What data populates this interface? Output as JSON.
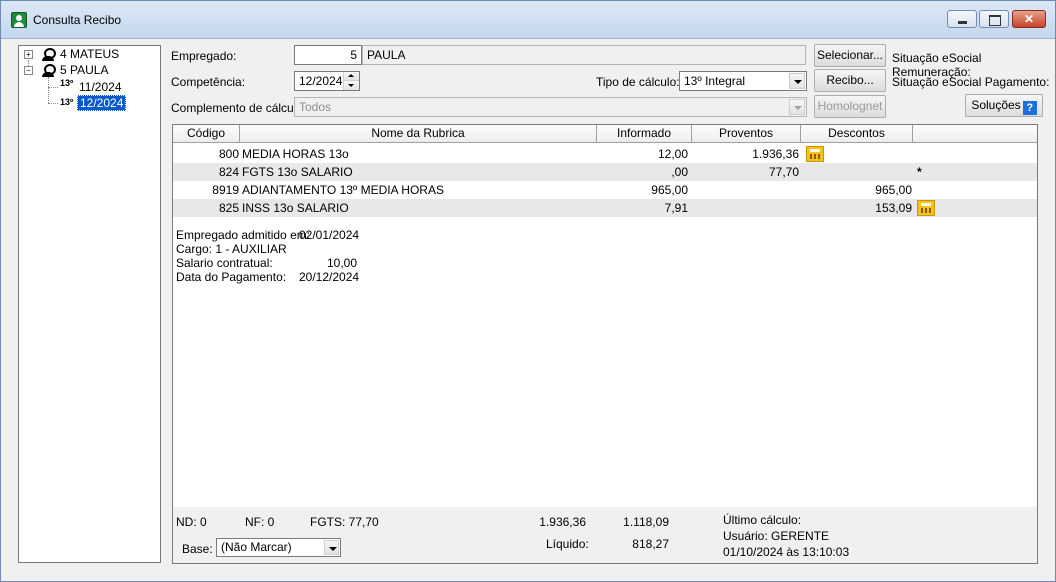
{
  "window": {
    "title": "Consulta Recibo"
  },
  "tree": {
    "items": [
      {
        "label": "4 MATEUS"
      },
      {
        "label": "5 PAULA"
      }
    ],
    "children": [
      {
        "badge": "13º",
        "label": "11/2024"
      },
      {
        "badge": "13º",
        "label": "12/2024"
      }
    ]
  },
  "form": {
    "empregado_label": "Empregado:",
    "empregado_code": "5",
    "empregado_name": "PAULA",
    "competencia_label": "Competência:",
    "competencia_value": "12/2024",
    "tipo_label": "Tipo de cálculo:",
    "tipo_value": "13º Integral",
    "complemento_label": "Complemento de cálculo:",
    "complemento_value": "Todos"
  },
  "buttons": {
    "selecionar": "Selecionar...",
    "recibo": "Recibo...",
    "homolognet": "Homolognet",
    "solucoes": "Soluções"
  },
  "status": {
    "remuneracao": "Situação eSocial Remuneração:",
    "pagamento": "Situação eSocial Pagamento:"
  },
  "grid": {
    "headers": [
      "Código",
      "Nome da Rubrica",
      "Informado",
      "Proventos",
      "Descontos"
    ],
    "rows": [
      {
        "codigo": "800",
        "nome": "MEDIA HORAS 13o",
        "informado": "12,00",
        "proventos": "1.936,36",
        "descontos": "",
        "marker": ""
      },
      {
        "codigo": "824",
        "nome": "FGTS 13o SALARIO",
        "informado": ",00",
        "proventos": "77,70",
        "descontos": "",
        "marker": "*"
      },
      {
        "codigo": "8919",
        "nome": "ADIANTAMENTO 13º MEDIA HORAS",
        "informado": "965,00",
        "proventos": "",
        "descontos": "965,00",
        "marker": ""
      },
      {
        "codigo": "825",
        "nome": "INSS 13o SALARIO",
        "informado": "7,91",
        "proventos": "",
        "descontos": "153,09",
        "marker": ""
      }
    ]
  },
  "info": {
    "admitido_label": "Empregado admitido em:",
    "admitido_value": "02/01/2024",
    "cargo": "Cargo: 1 - AUXILIAR",
    "salario_label": "Salario contratual:",
    "salario_value": "10,00",
    "pagamento_label": "Data do Pagamento:",
    "pagamento_value": "20/12/2024"
  },
  "footer": {
    "nd": "ND:  0",
    "nf": "NF:  0",
    "fgts": "FGTS:  77,70",
    "total_proventos": "1.936,36",
    "total_descontos": "1.118,09",
    "liquido_label": "Líquido:",
    "liquido_value": "818,27",
    "base_label": "Base:",
    "base_value": "(Não Marcar)",
    "ultimo_calculo": "Último cálculo:",
    "usuario": "Usuário: GERENTE",
    "data_calculo": "01/10/2024 às 13:10:03"
  }
}
